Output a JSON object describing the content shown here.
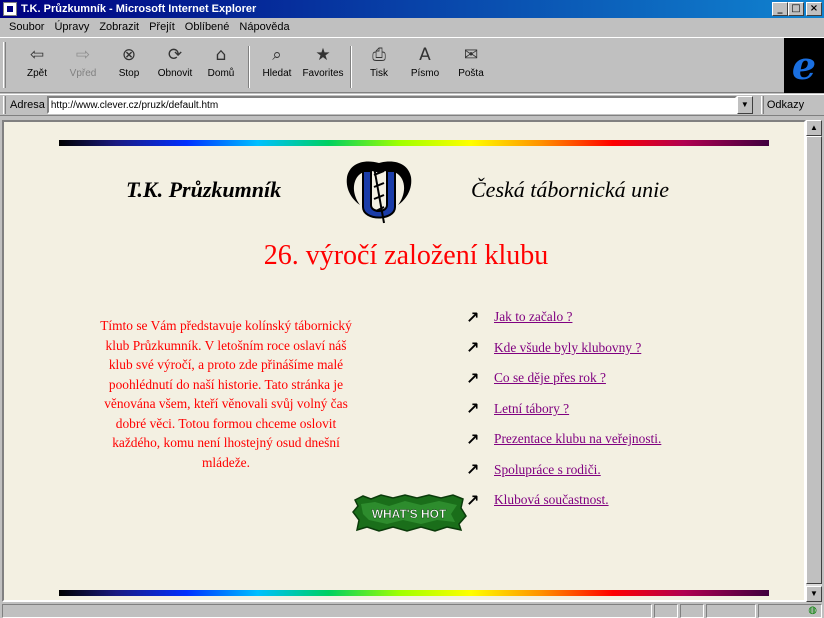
{
  "window": {
    "title": "T.K. Průzkumník - Microsoft Internet Explorer",
    "minimize": "_",
    "maximize": "□",
    "close": "×"
  },
  "menu": [
    "Soubor",
    "Úpravy",
    "Zobrazit",
    "Přejít",
    "Oblíbené",
    "Nápověda"
  ],
  "toolbar": {
    "back": "Zpět",
    "forward": "Vpřed",
    "stop": "Stop",
    "refresh": "Obnovit",
    "home": "Domů",
    "search": "Hledat",
    "favorites": "Favorites",
    "print": "Tisk",
    "font": "Písmo",
    "mail": "Pošta",
    "icons": {
      "back": "⇦",
      "forward": "⇨",
      "stop": "⊗",
      "refresh": "⟳",
      "home": "⌂",
      "search": "⌕",
      "favorites": "★",
      "print": "⎙",
      "font": "A",
      "mail": "✉"
    }
  },
  "address": {
    "label": "Adresa",
    "url": "http://www.clever.cz/pruzk/default.htm",
    "links_label": "Odkazy"
  },
  "page": {
    "club_name": "T.K. Průzkumník",
    "union_name": "Česká tábornická unie",
    "headline": "26. výročí založení klubu",
    "intro": "Tímto se Vám představuje kolínský tábornický klub Průzkumník. V letošním roce oslaví náš klub své výročí, a proto zde přinášíme malé poohlédnutí do naší historie. Tato stránka je věnována všem, kteří věnovali svůj volný čas dobré věci. Totou formou chceme oslovit každého, komu není lhostejný osud dnešní mládeže.",
    "links": [
      "Jak to začalo ?",
      "Kde všude byly klubovny ?",
      "Co se děje přes rok ?",
      "Letní tábory ?",
      "Prezentace klubu na veřejnosti.",
      "Spolupráce s rodiči.",
      "Klubová součastnost."
    ],
    "bullet": "↗",
    "hot_badge": "WHAT'S HOT"
  },
  "colors": {
    "link": "#800080",
    "headline": "#ff0000",
    "page_bg": "#f3f0e2",
    "title_bar": "#000080"
  }
}
